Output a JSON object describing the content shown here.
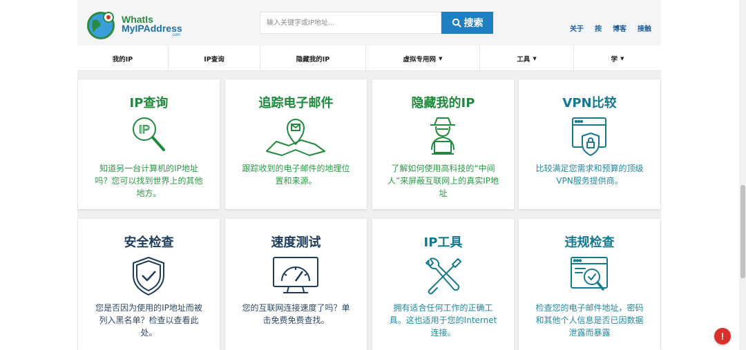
{
  "header": {
    "logo_line1": "WhatIs",
    "logo_line2": "MyIPAddress",
    "logo_sub": ".com",
    "search_placeholder": "输入关键字或IP地址...",
    "search_button": "搜索",
    "top_links": [
      "关于",
      "按",
      "博客",
      "接触"
    ]
  },
  "nav": {
    "items": [
      {
        "label": "我的IP",
        "caret": ""
      },
      {
        "label": "IP查询",
        "caret": ""
      },
      {
        "label": "隐藏我的IP",
        "caret": ""
      },
      {
        "label": "虚拟专用网",
        "caret": "▼"
      },
      {
        "label": "工具",
        "caret": "▼"
      },
      {
        "label": "学",
        "caret": "▼"
      }
    ]
  },
  "cards": [
    {
      "title": "IP查询",
      "desc": "知道另一台计算机的IP地址吗？您可以找到世界上的其他地方。",
      "icon": "ip-magnifier-icon",
      "color": "#1d8a3b"
    },
    {
      "title": "追踪电子邮件",
      "desc": "跟踪收到的电子邮件的地理位置和来源。",
      "icon": "email-map-pin-icon",
      "color": "#1d8a3b"
    },
    {
      "title": "隐藏我的IP",
      "desc": "了解如何使用高科技的“中间人”来屏蔽互联网上的真实IP地址",
      "icon": "hacker-icon",
      "color": "#1d8a3b"
    },
    {
      "title": "VPN比较",
      "desc": "比较满足您需求和预算的顶级VPN服务提供商。",
      "icon": "browser-lock-icon",
      "color": "#13788f"
    },
    {
      "title": "安全检查",
      "desc": "您是否因为使用的IP地址而被列入黑名单？检查以查看此处。",
      "icon": "shield-check-icon",
      "color": "#1c3a5a"
    },
    {
      "title": "速度测试",
      "desc": "您的互联网连接速度了吗？单击免费免费查找。",
      "icon": "speed-gauge-icon",
      "color": "#1c3a5a"
    },
    {
      "title": "IP工具",
      "desc": "拥有适合任何工作的正确工具。这也适用于您的Internet连接。",
      "icon": "wrench-screwdriver-icon",
      "color": "#13788f"
    },
    {
      "title": "违规检查",
      "desc": "检查您的电子邮件地址，密码和其他个人信息是否已因数据泄露而暴露",
      "icon": "browser-magnifier-check-icon",
      "color": "#13788f"
    }
  ],
  "fab": {
    "label": "!"
  }
}
